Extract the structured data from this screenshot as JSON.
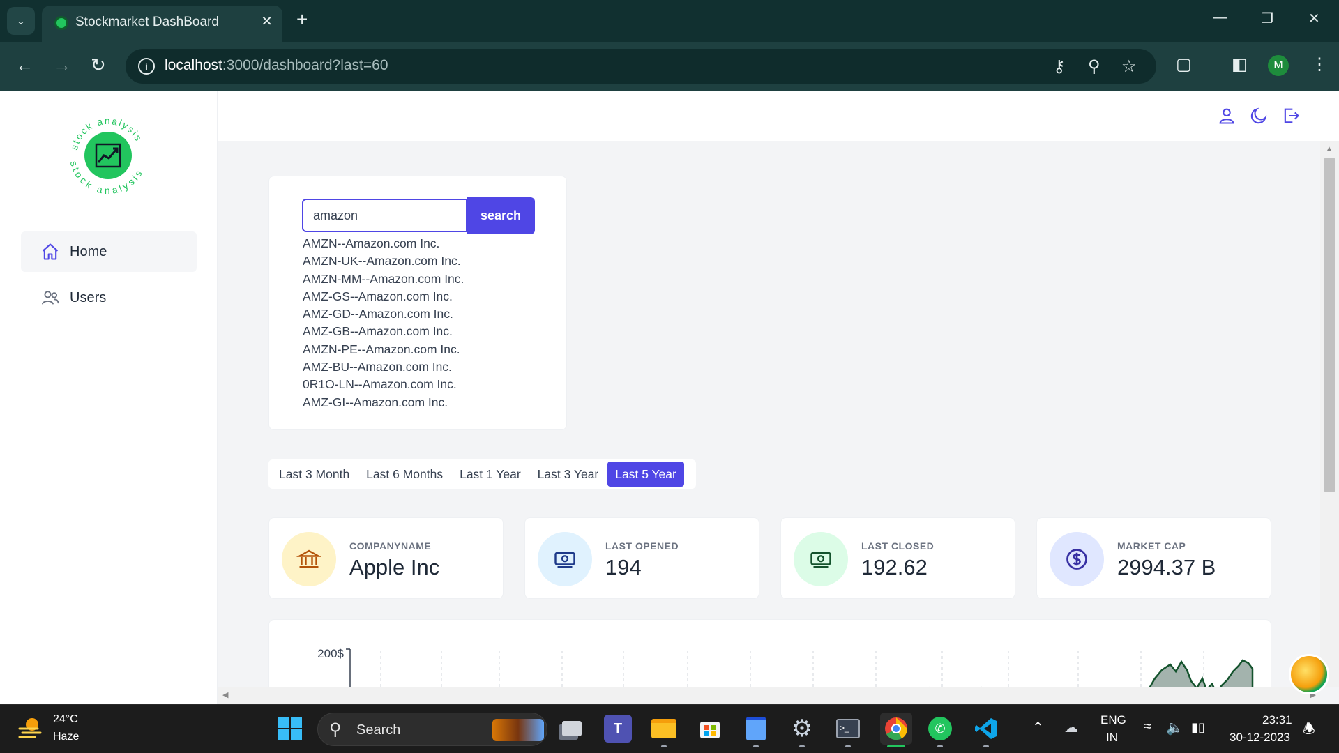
{
  "browser": {
    "tab_title": "Stockmarket DashBoard",
    "url_host": "localhost",
    "url_path": ":3000/dashboard?last=60",
    "profile_initial": "M"
  },
  "sidebar": {
    "logo_text": "stock analysis",
    "items": [
      {
        "label": "Home",
        "icon": "home-icon",
        "active": true
      },
      {
        "label": "Users",
        "icon": "users-icon",
        "active": false
      }
    ]
  },
  "topbar": {
    "icons": [
      "user-icon",
      "moon-icon",
      "logout-icon"
    ]
  },
  "search": {
    "value": "amazon",
    "button_label": "search",
    "suggestions": [
      "AMZN--Amazon.com Inc.",
      "AMZN-UK--Amazon.com Inc.",
      "AMZN-MM--Amazon.com Inc.",
      "AMZ-GS--Amazon.com Inc.",
      "AMZ-GD--Amazon.com Inc.",
      "AMZ-GB--Amazon.com Inc.",
      "AMZN-PE--Amazon.com Inc.",
      "AMZ-BU--Amazon.com Inc.",
      "0R1O-LN--Amazon.com Inc.",
      "AMZ-GI--Amazon.com Inc."
    ]
  },
  "ranges": [
    {
      "label": "Last 3 Month",
      "active": false
    },
    {
      "label": "Last 6 Months",
      "active": false
    },
    {
      "label": "Last 1 Year",
      "active": false
    },
    {
      "label": "Last 3 Year",
      "active": false
    },
    {
      "label": "Last 5 Year",
      "active": true
    }
  ],
  "stats": [
    {
      "label": "COMPANYNAME",
      "value": "Apple Inc",
      "icon": "bank-icon",
      "bg": "#fef3c7",
      "color": "#b45309"
    },
    {
      "label": "LAST OPENED",
      "value": "194",
      "icon": "cash-icon",
      "bg": "#e0f2fe",
      "color": "#1e3a8a"
    },
    {
      "label": "LAST CLOSED",
      "value": "192.62",
      "icon": "cash-icon",
      "bg": "#dcfce7",
      "color": "#14532d"
    },
    {
      "label": "MARKET CAP",
      "value": "2994.37 B",
      "icon": "dollar-circle-icon",
      "bg": "#e0e7ff",
      "color": "#3730a3"
    }
  ],
  "chart": {
    "y_tick_label": "200$"
  },
  "taskbar": {
    "weather_temp": "24°C",
    "weather_desc": "Haze",
    "search_label": "Search",
    "lang_line1": "ENG",
    "lang_line2": "IN",
    "time": "23:31",
    "date": "30-12-2023"
  },
  "colors": {
    "accent": "#4f46e5",
    "chart_line": "#14532d",
    "chart_fill": "#a3b3ad",
    "chart_highlight": "#22c55e"
  }
}
